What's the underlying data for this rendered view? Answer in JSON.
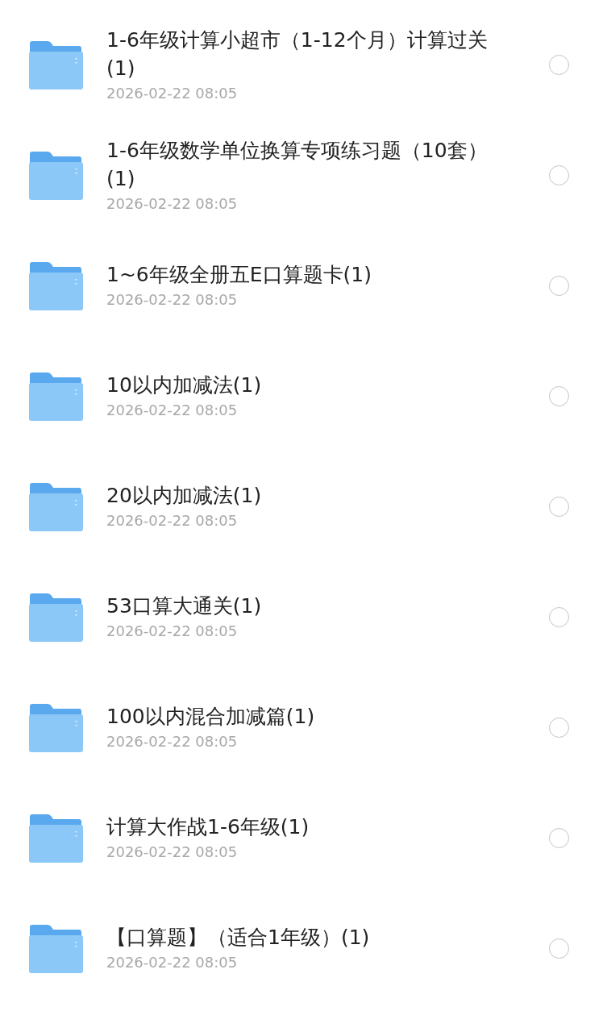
{
  "files": [
    {
      "name": "1-6年级计算小超市（1-12个月）计算过关(1)",
      "date": "2026-02-22 08:05",
      "selected": false
    },
    {
      "name": "1-6年级数学单位换算专项练习题（10套）(1)",
      "date": "2026-02-22 08:05",
      "selected": false
    },
    {
      "name": "1~6年级全册五E口算题卡(1)",
      "date": "2026-02-22 08:05",
      "selected": false
    },
    {
      "name": "10以内加减法(1)",
      "date": "2026-02-22 08:05",
      "selected": false
    },
    {
      "name": "20以内加减法(1)",
      "date": "2026-02-22 08:05",
      "selected": false
    },
    {
      "name": "53口算大通关(1)",
      "date": "2026-02-22 08:05",
      "selected": false
    },
    {
      "name": "100以内混合加减篇(1)",
      "date": "2026-02-22 08:05",
      "selected": false
    },
    {
      "name": "计算大作战1-6年级(1)",
      "date": "2026-02-22 08:05",
      "selected": false
    },
    {
      "name": "【口算题】（适合1年级）(1)",
      "date": "2026-02-22 08:05",
      "selected": false
    }
  ]
}
